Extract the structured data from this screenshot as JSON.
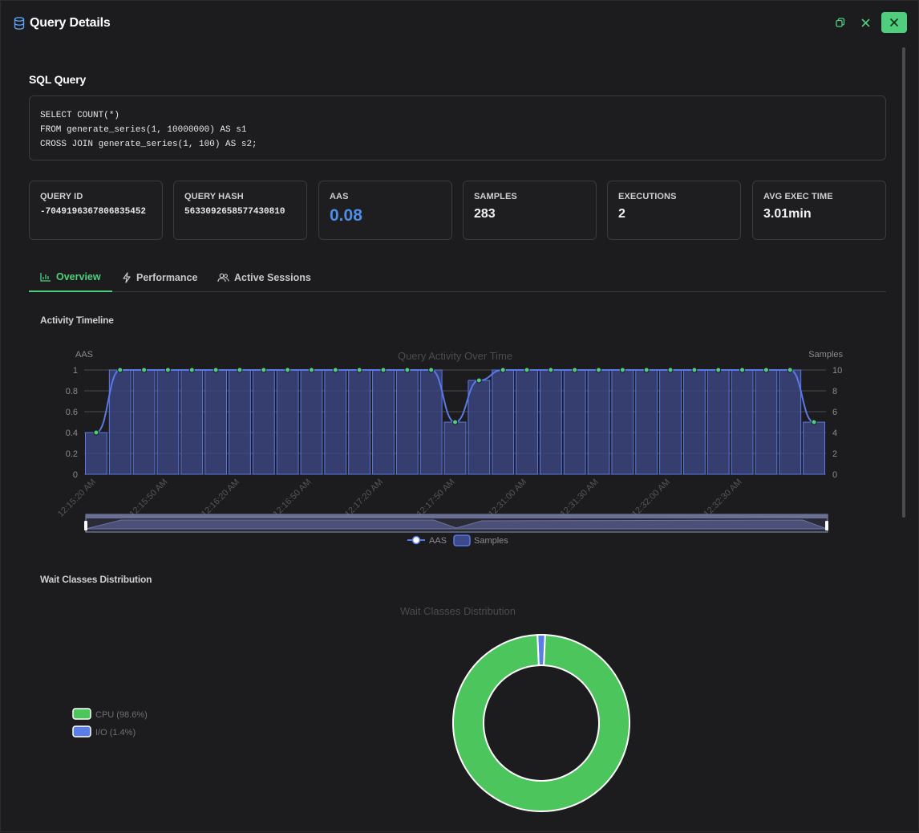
{
  "header": {
    "title": "Query Details"
  },
  "sql": {
    "heading": "SQL Query",
    "lines": [
      "SELECT COUNT(*)",
      "FROM generate_series(1, 10000000) AS s1",
      "CROSS JOIN generate_series(1, 100) AS s2;"
    ]
  },
  "cards": [
    {
      "label": "QUERY ID",
      "value": "-7049196367806835452"
    },
    {
      "label": "QUERY HASH",
      "value": "5633092658577430810"
    },
    {
      "label": "AAS",
      "value": "0.08"
    },
    {
      "label": "SAMPLES",
      "value": "283"
    },
    {
      "label": "EXECUTIONS",
      "value": "2"
    },
    {
      "label": "AVG EXEC TIME",
      "value": "3.01min"
    }
  ],
  "tabs": [
    {
      "label": "Overview",
      "icon": "bar-chart-icon",
      "active": true
    },
    {
      "label": "Performance",
      "icon": "bolt-icon",
      "active": false
    },
    {
      "label": "Active Sessions",
      "icon": "users-icon",
      "active": false
    }
  ],
  "activity": {
    "heading": "Activity Timeline",
    "legend": [
      "AAS",
      "Samples"
    ]
  },
  "wait": {
    "heading": "Wait Classes Distribution"
  },
  "colors": {
    "accent_green": "#4fce7d",
    "aas_line": "#5b79e6",
    "bars": "#3d4a8a",
    "cpu": "#4cc55c",
    "io": "#5b7ee6",
    "accent_blue": "#4e8ee8"
  },
  "chart_data": [
    {
      "type": "line",
      "title": "Query Activity Over Time",
      "x_ticks": [
        "12:15:20 AM",
        "12:15:50 AM",
        "12:16:20 AM",
        "12:16:50 AM",
        "12:17:20 AM",
        "12:17:50 AM",
        "12:31:00 AM",
        "12:31:30 AM",
        "12:32:00 AM",
        "12:32:30 AM"
      ],
      "y_left_label": "AAS",
      "y_left_ticks": [
        "0",
        "0.2",
        "0.4",
        "0.6",
        "0.8",
        "1"
      ],
      "y_left_lim": [
        0,
        1
      ],
      "y_right_label": "Samples",
      "y_right_ticks": [
        "0",
        "2",
        "4",
        "6",
        "8",
        "10"
      ],
      "y_right_lim": [
        0,
        10
      ],
      "legend_position": "bottom",
      "series": [
        {
          "name": "AAS",
          "kind": "line",
          "values": [
            0.4,
            1,
            1,
            1,
            1,
            1,
            1,
            1,
            1,
            1,
            1,
            1,
            1,
            1,
            1,
            0.5,
            0.9,
            1,
            1,
            1,
            1,
            1,
            1,
            1,
            1,
            1,
            1,
            1,
            1,
            1,
            0.5
          ]
        },
        {
          "name": "Samples",
          "kind": "bar",
          "values": [
            4,
            10,
            10,
            10,
            10,
            10,
            10,
            10,
            10,
            10,
            10,
            10,
            10,
            10,
            10,
            5,
            9,
            10,
            10,
            10,
            10,
            10,
            10,
            10,
            10,
            10,
            10,
            10,
            10,
            10,
            5
          ]
        }
      ]
    },
    {
      "type": "pie",
      "title": "Wait Classes Distribution",
      "legend_position": "left",
      "slices": [
        {
          "name": "CPU",
          "label": "CPU (98.6%)",
          "value": 98.6
        },
        {
          "name": "I/O",
          "label": "I/O (1.4%)",
          "value": 1.4
        }
      ]
    }
  ]
}
